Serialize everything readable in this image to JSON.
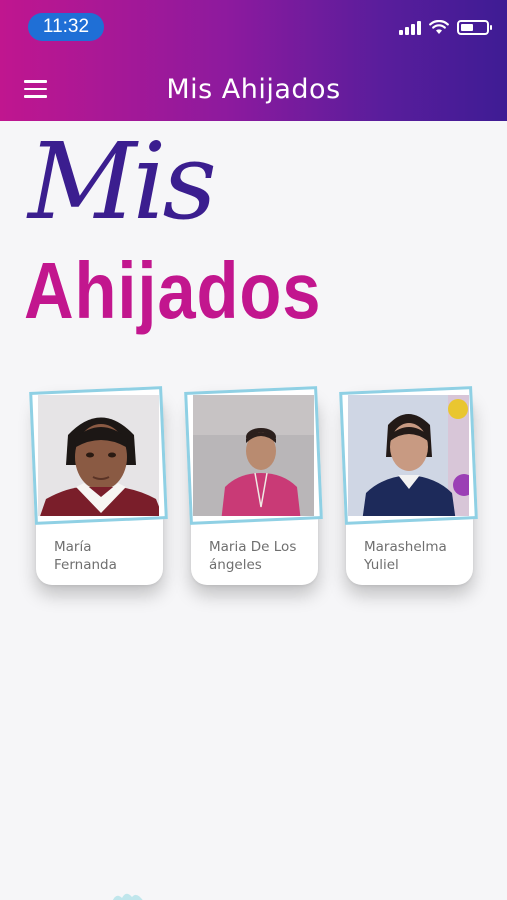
{
  "status_bar": {
    "time": "11:32"
  },
  "header": {
    "title": "Mis Ahijados",
    "menu_icon": "hamburger-menu-icon"
  },
  "hero": {
    "line1": "Mis",
    "line2": "Ahijados"
  },
  "colors": {
    "header_start": "#c0168f",
    "header_end": "#3e1c94",
    "hero_purple": "#3b1e8f",
    "hero_magenta": "#c2168e",
    "frame": "#8fd0e4"
  },
  "godchildren": [
    {
      "name": "María Fernanda"
    },
    {
      "name": "Maria De Los ángeles"
    },
    {
      "name": "Marashelma Yuliel"
    }
  ]
}
